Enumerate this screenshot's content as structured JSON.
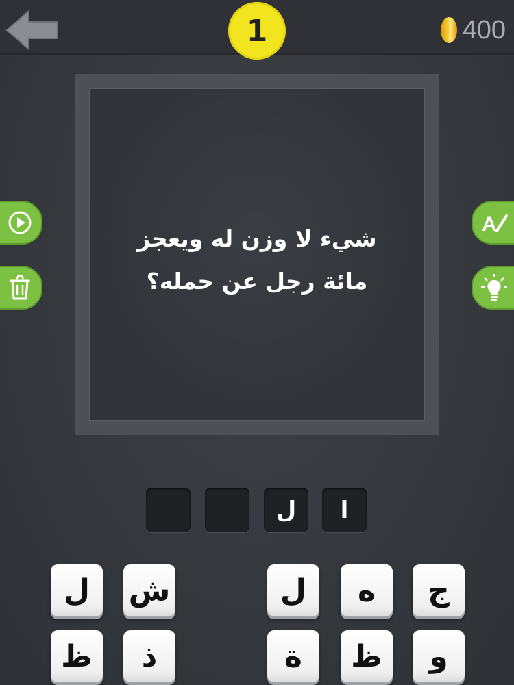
{
  "header": {
    "back_icon": "arrow-left-icon",
    "level": "1",
    "coins": "400",
    "coin_icon": "coin-icon"
  },
  "question": {
    "line1": "شيء لا وزن له ويعجز",
    "line2": "مائة رجل عن حمله؟"
  },
  "side_buttons": {
    "left": [
      {
        "icon": "play-icon"
      },
      {
        "icon": "trash-icon"
      }
    ],
    "right": [
      {
        "icon": "reveal-letter-icon",
        "label": "A"
      },
      {
        "icon": "lightbulb-icon"
      }
    ]
  },
  "answer": {
    "slots": [
      "ا",
      "ل",
      "",
      ""
    ]
  },
  "keyboard": {
    "row1": [
      "ج",
      "ه",
      "ل",
      "ش",
      "ل"
    ],
    "row2": [
      "و",
      "ظ",
      "ة",
      "ذ",
      "ظ"
    ]
  },
  "colors": {
    "accent_green": "#7dc142",
    "badge_yellow": "#f2e41e",
    "background": "#35383d"
  }
}
